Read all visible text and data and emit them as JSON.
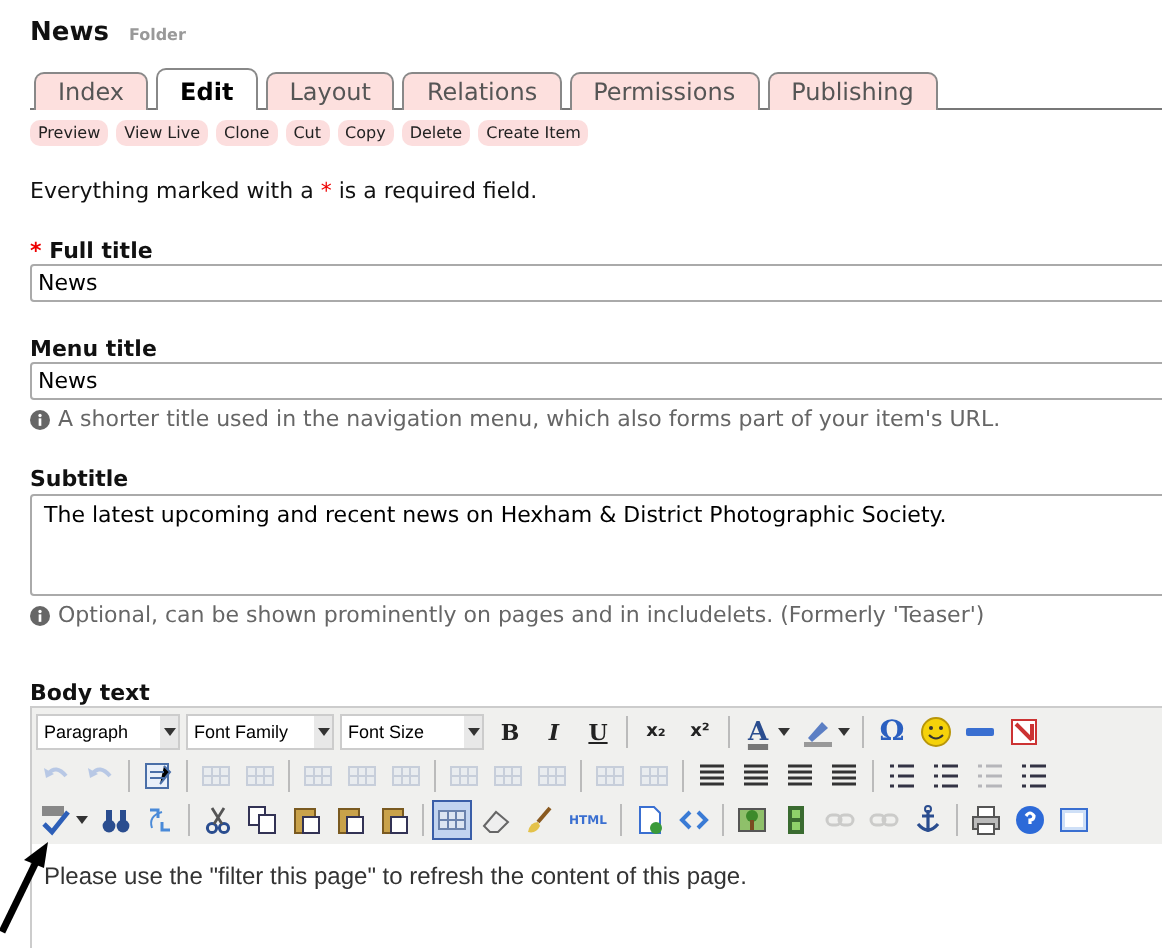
{
  "header": {
    "title": "News",
    "type": "Folder"
  },
  "tabs": [
    {
      "label": "Index",
      "selected": false
    },
    {
      "label": "Edit",
      "selected": true
    },
    {
      "label": "Layout",
      "selected": false
    },
    {
      "label": "Relations",
      "selected": false
    },
    {
      "label": "Permissions",
      "selected": false
    },
    {
      "label": "Publishing",
      "selected": false
    }
  ],
  "actions": [
    "Preview",
    "View Live",
    "Clone",
    "Cut",
    "Copy",
    "Delete",
    "Create Item"
  ],
  "required_note": {
    "before": "Everything marked with a",
    "mark": "*",
    "after": "is a required field."
  },
  "fields": [
    {
      "kind": "input",
      "label": "Full title",
      "required": true,
      "required_mark": "*",
      "value": "News"
    },
    {
      "kind": "input",
      "label": "Menu title",
      "value": "News",
      "help": "A shorter title used in the navigation menu, which also forms part of your item's URL."
    },
    {
      "kind": "textarea",
      "label": "Subtitle",
      "value": "The latest upcoming and recent news on Hexham & District Photographic Society.",
      "help": "Optional, can be shown prominently on pages and in includelets. (Formerly 'Teaser')"
    }
  ],
  "body_text": {
    "label": "Body text",
    "dropdowns": [
      "Paragraph",
      "Font Family",
      "Font Size"
    ],
    "toolbar_rows": [
      [
        {
          "kind": "text",
          "label": "B",
          "disabled": false
        },
        {
          "kind": "text",
          "label": "I",
          "disabled": false
        },
        {
          "kind": "text",
          "label": "U",
          "disabled": false
        },
        {
          "kind": "separator"
        },
        {
          "kind": "text",
          "label": "x₂",
          "disabled": false
        },
        {
          "kind": "text",
          "label": "x²",
          "disabled": false
        },
        {
          "kind": "separator"
        },
        {
          "kind": "text",
          "label": "A",
          "disabled": false
        },
        {
          "kind": "icon",
          "disabled": false
        },
        {
          "kind": "separator"
        },
        {
          "kind": "text",
          "label": "Ω",
          "disabled": false
        },
        {
          "kind": "icon",
          "disabled": false
        },
        {
          "kind": "icon",
          "disabled": false
        },
        {
          "kind": "icon",
          "disabled": false
        }
      ],
      [
        {
          "kind": "icon",
          "disabled": true
        },
        {
          "kind": "icon",
          "disabled": true
        },
        {
          "kind": "separator"
        },
        {
          "kind": "icon",
          "disabled": false
        },
        {
          "kind": "separator"
        },
        {
          "kind": "icon",
          "disabled": true
        },
        {
          "kind": "icon",
          "disabled": true
        },
        {
          "kind": "separator"
        },
        {
          "kind": "icon",
          "disabled": true
        },
        {
          "kind": "icon",
          "disabled": true
        },
        {
          "kind": "icon",
          "disabled": true
        },
        {
          "kind": "separator"
        },
        {
          "kind": "icon",
          "disabled": true
        },
        {
          "kind": "icon",
          "disabled": true
        },
        {
          "kind": "icon",
          "disabled": true
        },
        {
          "kind": "separator"
        },
        {
          "kind": "icon",
          "disabled": true
        },
        {
          "kind": "icon",
          "disabled": true
        },
        {
          "kind": "separator"
        },
        {
          "kind": "icon",
          "disabled": false
        },
        {
          "kind": "icon",
          "disabled": false
        },
        {
          "kind": "icon",
          "disabled": false
        },
        {
          "kind": "icon",
          "disabled": false
        },
        {
          "kind": "separator"
        },
        {
          "kind": "icon",
          "disabled": false
        },
        {
          "kind": "icon",
          "disabled": false
        },
        {
          "kind": "icon",
          "disabled": true
        },
        {
          "kind": "icon",
          "disabled": false
        }
      ],
      [
        {
          "kind": "icon",
          "disabled": false
        },
        {
          "kind": "icon",
          "disabled": false
        },
        {
          "kind": "icon",
          "disabled": false
        },
        {
          "kind": "separator"
        },
        {
          "kind": "icon",
          "disabled": false
        },
        {
          "kind": "icon",
          "disabled": false
        },
        {
          "kind": "icon",
          "disabled": false
        },
        {
          "kind": "icon",
          "disabled": false
        },
        {
          "kind": "icon",
          "disabled": false
        },
        {
          "kind": "separator"
        },
        {
          "kind": "icon",
          "disabled": false,
          "selected": true
        },
        {
          "kind": "icon",
          "disabled": false
        },
        {
          "kind": "icon",
          "disabled": false
        },
        {
          "kind": "text",
          "label": "HTML",
          "disabled": false
        },
        {
          "kind": "separator"
        },
        {
          "kind": "icon",
          "disabled": false
        },
        {
          "kind": "icon",
          "disabled": false
        },
        {
          "kind": "separator"
        },
        {
          "kind": "icon",
          "disabled": false
        },
        {
          "kind": "icon",
          "disabled": false
        },
        {
          "kind": "icon",
          "disabled": true
        },
        {
          "kind": "icon",
          "disabled": true
        },
        {
          "kind": "icon",
          "disabled": false
        },
        {
          "kind": "separator"
        },
        {
          "kind": "icon",
          "disabled": false
        },
        {
          "kind": "icon",
          "disabled": false
        },
        {
          "kind": "icon",
          "disabled": false
        }
      ]
    ],
    "content": "Please use the \"filter this page\" to refresh the content of this page."
  },
  "annotation": {
    "kind": "arrow"
  }
}
